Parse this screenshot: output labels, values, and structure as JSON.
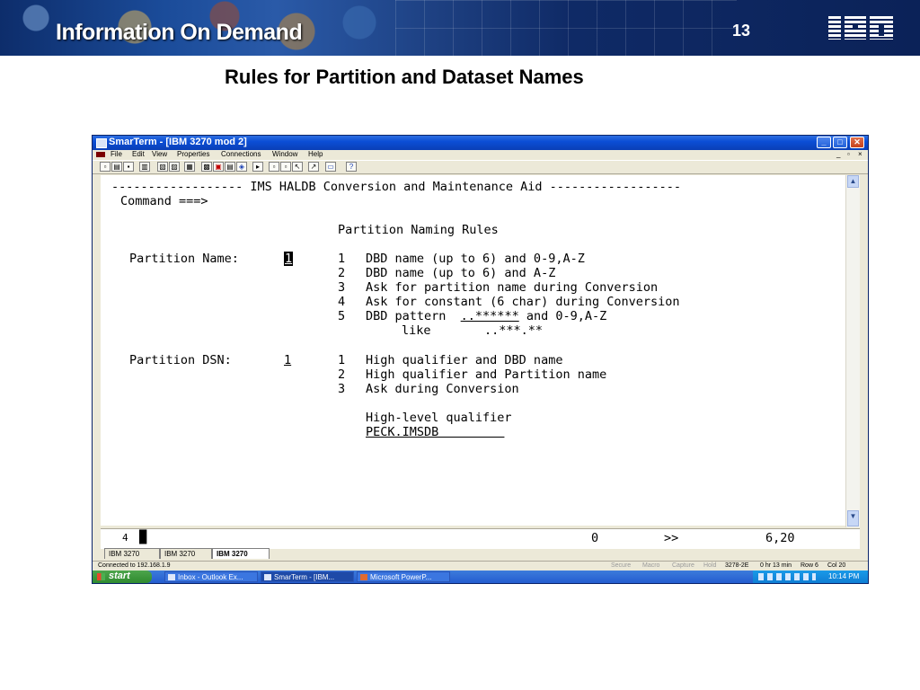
{
  "slide": {
    "banner_title": "Information On Demand",
    "page_number": "13",
    "logo_text": "IBM",
    "title": "Rules for Partition and Dataset Names"
  },
  "window": {
    "title": "SmarTerm - [IBM 3270 mod 2]",
    "menu": [
      "File",
      "Edit",
      "View",
      "Properties",
      "Connections",
      "Window",
      "Help"
    ],
    "title_buttons": {
      "minimize": "_",
      "maximize": "□",
      "close": "✕"
    },
    "menu_controls": [
      "_",
      "▫",
      "×"
    ]
  },
  "terminal": {
    "header": "------------------ IMS HALDB Conversion and Maintenance Aid ------------------",
    "command_label": "Command ===>",
    "section_title": "Partition Naming Rules",
    "partition_name": {
      "label": "Partition Name:",
      "value": "1",
      "options": [
        {
          "num": "1",
          "text": "DBD name (up to 6) and 0-9,A-Z"
        },
        {
          "num": "2",
          "text": "DBD name (up to 6) and A-Z"
        },
        {
          "num": "3",
          "text": "Ask for partition name during Conversion"
        },
        {
          "num": "4",
          "text": "Ask for constant (6 char) during Conversion"
        },
        {
          "num": "5",
          "text_before": "DBD pattern  ",
          "pattern": "..******",
          "text_after": " and 0-9,A-Z"
        }
      ],
      "like_label": "like",
      "like_value": "..***.**"
    },
    "partition_dsn": {
      "label": "Partition DSN:",
      "value": "1",
      "options": [
        {
          "num": "1",
          "text": "High qualifier and DBD name"
        },
        {
          "num": "2",
          "text": "High qualifier and Partition name"
        },
        {
          "num": "3",
          "text": "Ask during Conversion"
        }
      ]
    },
    "hlq_label": "High-level qualifier",
    "hlq_value": "PECK.IMSDB         "
  },
  "oia": {
    "session": "4",
    "left_value": "0",
    "arrows": ">>",
    "cursor_pos": "6,20"
  },
  "session_tabs": [
    "IBM 3270",
    "IBM 3270",
    "IBM 3270"
  ],
  "statusbar": {
    "connected": "Connected to 192.168.1.9",
    "secure": "Secure",
    "macro": "Macro",
    "capture": "Capture",
    "hold": "Hold",
    "terminal_type": "3278-2E",
    "elapsed": "0 hr 13 min",
    "row": "Row 6",
    "col": "Col 20"
  },
  "taskbar": {
    "start": "start",
    "tasks": [
      "Inbox - Outlook Ex...",
      "SmarTerm - [IBM...",
      "Microsoft PowerP..."
    ],
    "clock": "10:14 PM"
  }
}
